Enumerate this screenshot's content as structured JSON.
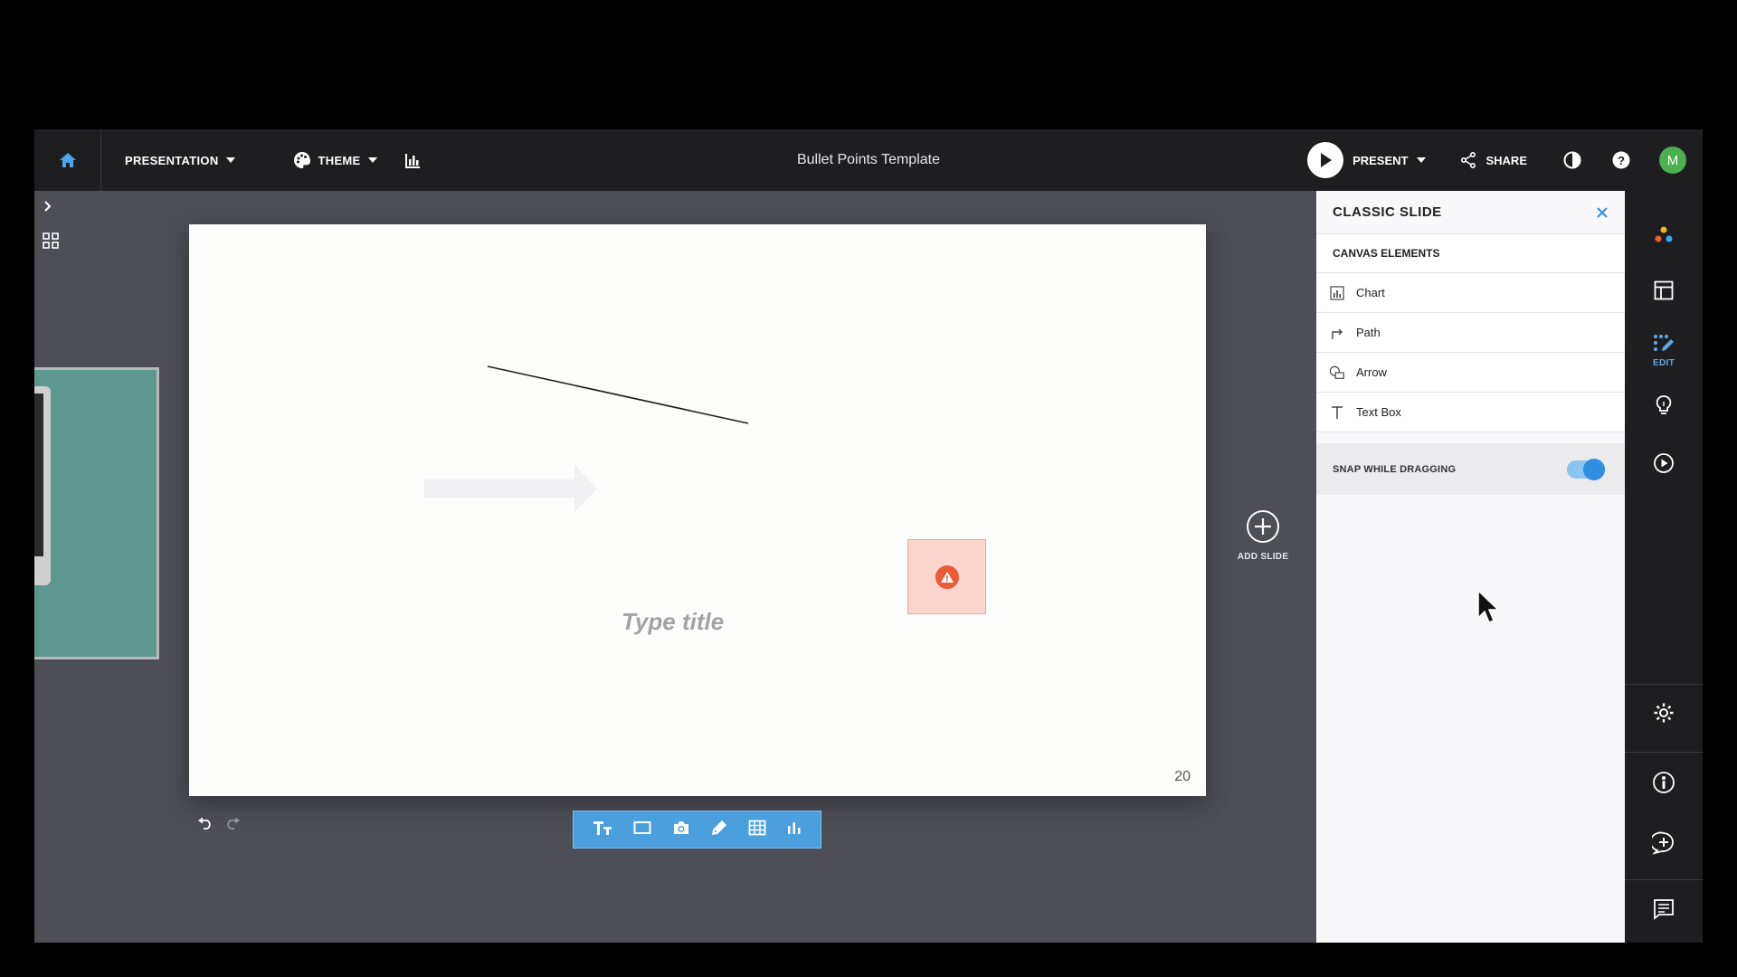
{
  "topbar": {
    "presentation_label": "PRESENTATION",
    "theme_label": "THEME",
    "doc_title": "Bullet Points Template",
    "present_label": "PRESENT",
    "share_label": "SHARE",
    "avatar_initial": "M"
  },
  "slide": {
    "title_placeholder": "Type title",
    "page_number": "20"
  },
  "add_slide_label": "ADD SLIDE",
  "panel": {
    "title": "CLASSIC SLIDE",
    "section_label": "CANVAS ELEMENTS",
    "elements": [
      {
        "label": "Chart",
        "icon": "chart-icon"
      },
      {
        "label": "Path",
        "icon": "path-icon"
      },
      {
        "label": "Arrow",
        "icon": "arrow-shape-icon"
      },
      {
        "label": "Text Box",
        "icon": "text-box-icon"
      }
    ],
    "snap_label": "SNAP WHILE DRAGGING",
    "snap_enabled": true
  },
  "rail": {
    "edit_label": "EDIT"
  },
  "colors": {
    "accent": "#2f8ee0",
    "toolbar_blue": "#4a9fdc",
    "topbar": "#1e1e21",
    "workspace": "#4d4e56",
    "warning": "#ea5c36"
  }
}
